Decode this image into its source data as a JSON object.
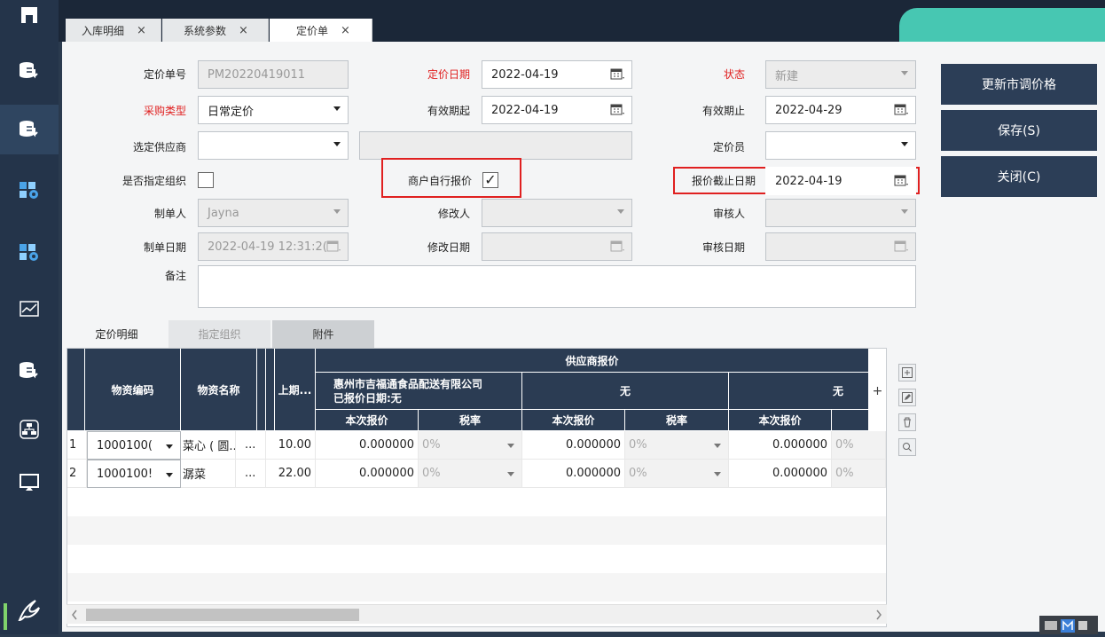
{
  "sidebar": {
    "items": [
      "home-icon",
      "database-download-icon",
      "database-download-icon",
      "settings-grid-icon",
      "settings-grid-icon",
      "line-chart-icon",
      "database-download-icon",
      "network-icon",
      "monitor-icon"
    ]
  },
  "tabs": [
    {
      "label": "入库明细"
    },
    {
      "label": "系统参数"
    },
    {
      "label": "定价单"
    }
  ],
  "tab_close": "×",
  "form": {
    "order_no": {
      "label": "定价单号",
      "value": "PM20220419011"
    },
    "price_date": {
      "label": "定价日期",
      "value": "2022-04-19"
    },
    "status": {
      "label": "状态",
      "value": "新建"
    },
    "purchase_type": {
      "label": "采购类型",
      "value": "日常定价"
    },
    "valid_from": {
      "label": "有效期起",
      "value": "2022-04-19"
    },
    "valid_to": {
      "label": "有效期止",
      "value": "2022-04-29"
    },
    "supplier": {
      "label": "选定供应商",
      "value": ""
    },
    "pricer": {
      "label": "定价员",
      "value": ""
    },
    "designated_org": {
      "label": "是否指定组织"
    },
    "self_quote": {
      "label": "商户自行报价",
      "check": "✓"
    },
    "quote_deadline": {
      "label": "报价截止日期",
      "value": "2022-04-19"
    },
    "creator": {
      "label": "制单人",
      "value": "Jayna"
    },
    "modifier": {
      "label": "修改人",
      "value": ""
    },
    "reviewer": {
      "label": "审核人",
      "value": ""
    },
    "create_date": {
      "label": "制单日期",
      "value": "2022-04-19 12:31:2("
    },
    "modify_date": {
      "label": "修改日期",
      "value": ""
    },
    "review_date": {
      "label": "审核日期",
      "value": ""
    },
    "remark": {
      "label": "备注",
      "value": ""
    }
  },
  "buttons": {
    "update_price": "更新市调价格",
    "save": "保存(S)",
    "close": "关闭(C)"
  },
  "subtabs": [
    "定价明细",
    "指定组织",
    "附件"
  ],
  "grid": {
    "headers": {
      "code": "物资编码",
      "name": "物资名称",
      "last": "上期...",
      "supplier_quote": "供应商报价",
      "supplier1": "惠州市吉福通食品配送有限公司",
      "supplier1_sub": "已报价日期:无",
      "supplier2": "无",
      "supplier3": "无",
      "cur_quote": "本次报价",
      "tax_rate": "税率"
    },
    "rows": [
      {
        "no": "1",
        "code": "1000100(",
        "name": "菜心 ( 圆...",
        "more": "...",
        "last": "10.00",
        "q1": "0.000000",
        "t1": "0%",
        "q2": "0.000000",
        "t2": "0%",
        "q3": "0.000000",
        "t3": "0%"
      },
      {
        "no": "2",
        "code": "1000100!",
        "name": "潺菜",
        "more": "...",
        "last": "22.00",
        "q1": "0.000000",
        "t1": "0%",
        "q2": "0.000000",
        "t2": "0%",
        "q3": "0.000000",
        "t3": "0%"
      }
    ],
    "plus_glyph": "+"
  },
  "colors": {
    "sidebar": "#24344a",
    "header": "#2b3c53",
    "teal": "#47c7b2",
    "required": "#e02020",
    "button": "#2c3e57"
  }
}
